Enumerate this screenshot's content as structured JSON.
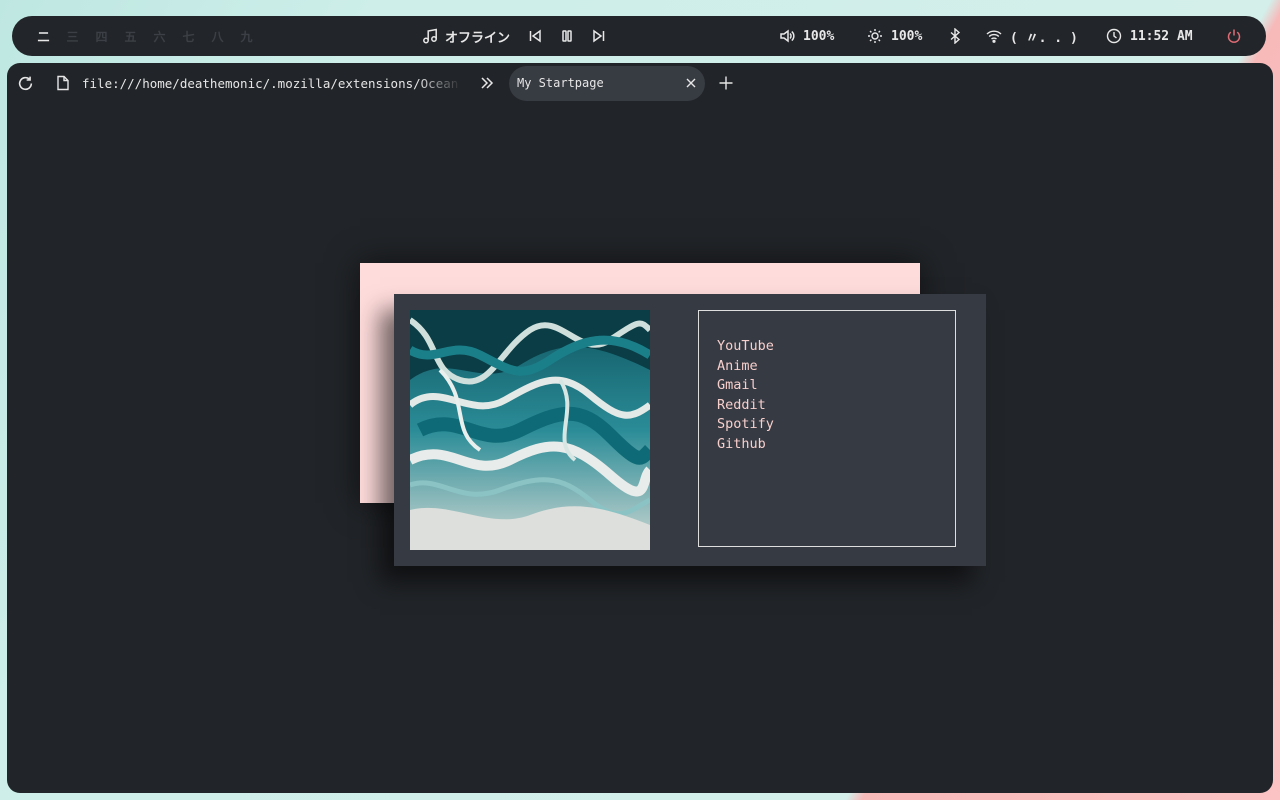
{
  "topbar": {
    "workspaces": [
      "二",
      "三",
      "四",
      "五",
      "六",
      "七",
      "八",
      "九"
    ],
    "active_workspace": "二",
    "music": {
      "icon": "music-note-icon",
      "status": "オフライン",
      "controls": [
        "previous-icon",
        "pause-icon",
        "next-icon"
      ]
    },
    "volume": "100%",
    "brightness": "100%",
    "wifi": "( 〃. . )",
    "clock": "11:52 AM",
    "colors": {
      "bar_bg": "#222529",
      "power": "#e06c75",
      "inactive_workspace": "#3c4046"
    }
  },
  "browser": {
    "url": "file:///home/deathemonic/.mozilla/extensions/Ocean",
    "tab_title": "My Startpage",
    "colors": {
      "window_bg": "#212428",
      "tab_bg": "#373b42"
    }
  },
  "startpage": {
    "links": [
      "YouTube",
      "Anime",
      "Gmail",
      "Reddit",
      "Spotify",
      "Github"
    ],
    "colors": {
      "back_card": "#ffdcdc",
      "front_card": "#363a42",
      "link_text": "#f7cfcd"
    }
  }
}
